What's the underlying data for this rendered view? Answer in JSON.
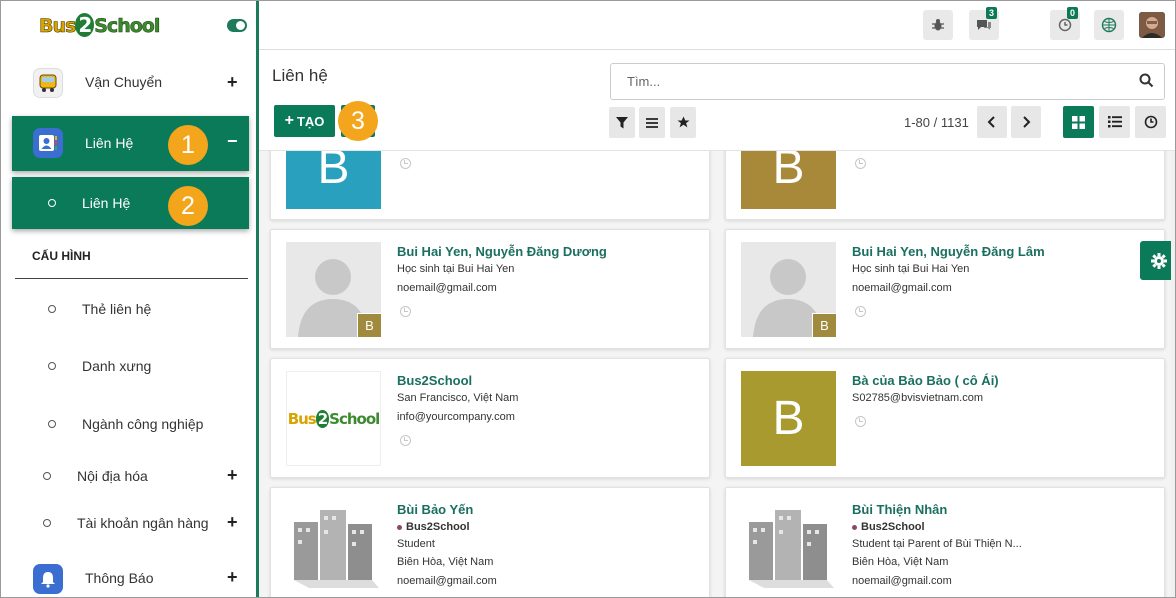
{
  "sidebar": {
    "logo": {
      "part1": "Bus",
      "part2": "2",
      "part3": "School"
    },
    "menu": [
      {
        "label": "Vận Chuyển",
        "icon": "bus-icon"
      },
      {
        "label": "Liên Hệ",
        "icon": "contacts-icon"
      }
    ],
    "active_sub": "Liên Hệ",
    "section_title": "CẤU HÌNH",
    "config_items": [
      "Thẻ liên hệ",
      "Danh xưng",
      "Ngành công nghiệp",
      "Nội địa hóa",
      "Tài khoản ngân hàng"
    ],
    "bottom_app": {
      "label": "Thông Báo",
      "icon": "bell-icon"
    },
    "badges": [
      "1",
      "2",
      "3"
    ]
  },
  "topbar": {
    "messages_count": "3",
    "activities_count": "0",
    "icons": [
      "bug-icon",
      "chat-icon",
      "clock-activity-icon",
      "globe-icon",
      "user-avatar"
    ]
  },
  "control": {
    "title": "Liên hệ",
    "search_placeholder": "Tìm...",
    "create_label": "TẠO",
    "pager": "1-80 / 1131"
  },
  "cards": [
    {
      "name": "",
      "lines": [],
      "letter": "B",
      "bg": "#2aa0bf",
      "type": "letter"
    },
    {
      "name": "",
      "lines": [],
      "letter": "B",
      "bg": "#a8893a",
      "type": "letter"
    },
    {
      "name": "Bui Hai Yen, Nguyễn Đăng Dương",
      "lines": [
        "Học sinh tại Bui Hai Yen",
        "noemail@gmail.com"
      ],
      "mini": "B",
      "type": "person"
    },
    {
      "name": "Bui Hai Yen, Nguyễn Đăng Lâm",
      "lines": [
        "Học sinh tại Bui Hai Yen",
        "noemail@gmail.com"
      ],
      "mini": "B",
      "type": "person"
    },
    {
      "name": "Bus2School",
      "lines": [
        "San Francisco, Việt Nam",
        "info@yourcompany.com"
      ],
      "type": "logo"
    },
    {
      "name": "Bà của Bảo Bảo ( cô Ái)",
      "lines": [
        "S02785@bvisvietnam.com"
      ],
      "letter": "B",
      "bg": "#a89a2e",
      "type": "letter"
    },
    {
      "name": "Bùi Bảo Yến",
      "tag": "Bus2School",
      "lines": [
        "Student",
        "Biên Hòa, Việt Nam",
        "noemail@gmail.com"
      ],
      "type": "company"
    },
    {
      "name": "Bùi Thiện Nhân",
      "tag": "Bus2School",
      "lines": [
        "Student tại Parent of Bùi Thiện N...",
        "Biên Hòa, Việt Nam",
        "noemail@gmail.com"
      ],
      "type": "company"
    }
  ],
  "colors": {
    "accent": "#0b7a58",
    "badge": "#f3a51c",
    "name": "#1a6f60"
  }
}
